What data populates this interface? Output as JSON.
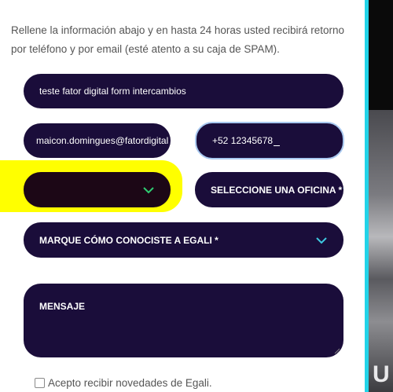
{
  "intro_text": "Rellene la información abajo y en hasta 24 horas usted recibirá retorno por teléfono y por email (esté atento a su caja de SPAM).",
  "form": {
    "name_value": "teste fator digital form intercambios",
    "email_value": "maicon.domingues@fatordigital",
    "phone_value": "+52 12345678",
    "first_select_value": "",
    "office_select_label": "SELECCIONE UNA OFICINA *",
    "referral_select_label": "MARQUE CÓMO CONOCISTE A EGALI *",
    "message_placeholder": "MENSAJE",
    "newsletter_label": "Acepto recibir novedades de Egali."
  },
  "side_panel": {
    "letter": "U"
  },
  "colors": {
    "field_bg": "#1a0d3a",
    "chevron": "#3ec8e0",
    "chevron_green": "#2ecc71",
    "highlight": "#ffff00",
    "accent_teal": "#22d3e8"
  },
  "icons": [
    "chevron-down-icon",
    "resize-handle-icon",
    "checkbox-icon"
  ]
}
